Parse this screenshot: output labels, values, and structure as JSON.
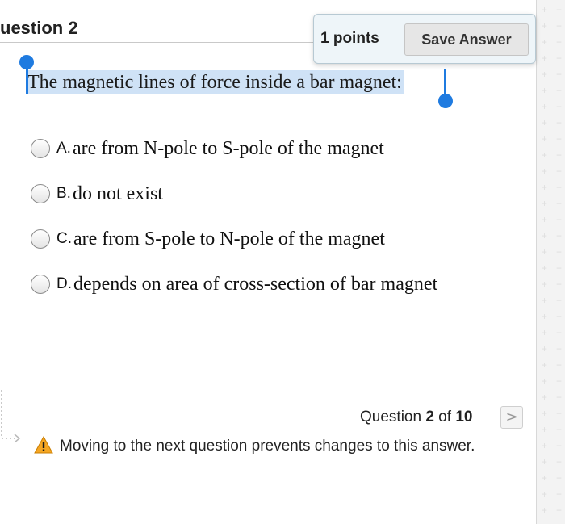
{
  "header": {
    "question_title": "uestion 2",
    "points": "1 points",
    "save_label": "Save Answer"
  },
  "question": {
    "text": "The magnetic lines of force inside a bar magnet:"
  },
  "options": [
    {
      "letter": "A.",
      "text": "are from N-pole to S-pole of the magnet",
      "selected": false
    },
    {
      "letter": "B.",
      "text": "do not exist",
      "selected": false
    },
    {
      "letter": "C.",
      "text": "are from S-pole to N-pole of the magnet",
      "selected": false
    },
    {
      "letter": "D.",
      "text": "depends on area of cross-section of bar magnet",
      "selected": false
    }
  ],
  "footer": {
    "counter_prefix": "Question ",
    "current": "2",
    "counter_mid": " of ",
    "total": "10",
    "next_glyph": ">",
    "warning": "Moving to the next question prevents changes to this answer."
  },
  "colors": {
    "selection_highlight": "#cfe2f6",
    "selection_handle": "#1f7be0",
    "warning_icon": "#f5a623"
  },
  "icons": {
    "warning": "warning-triangle-icon",
    "next": "chevron-right-icon"
  }
}
